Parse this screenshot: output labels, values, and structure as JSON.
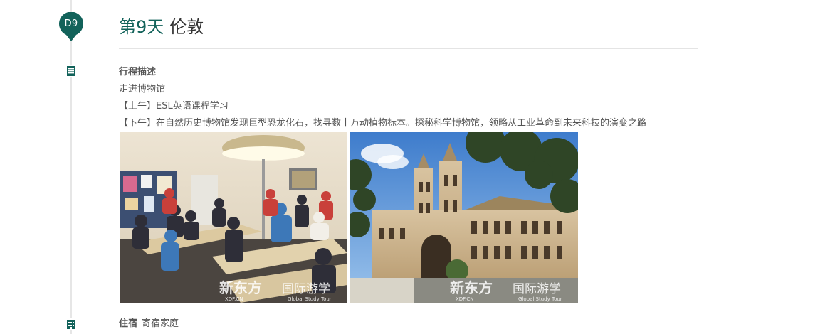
{
  "day": {
    "badge": "D9",
    "title_day": "第9天",
    "title_city": "伦敦"
  },
  "itinerary": {
    "label": "行程描述",
    "lines": [
      "走进博物馆",
      "【上午】ESL英语课程学习",
      "【下午】在自然历史博物馆发现巨型恐龙化石，找寻数十万动植物标本。探秘科学博物馆，领略从工业革命到未来科技的演变之路"
    ]
  },
  "photos": [
    {
      "watermark_brand": "新东方",
      "watermark_sub": "XDF.CN",
      "watermark_tour": "国际游学",
      "watermark_tour_en": "Global Study Tour"
    },
    {
      "watermark_brand": "新东方",
      "watermark_sub": "XDF.CN",
      "watermark_tour": "国际游学",
      "watermark_tour_en": "Global Study Tour"
    }
  ],
  "lodging": {
    "label": "住宿",
    "value": "寄宿家庭"
  },
  "icons": {
    "day_pin": "map-pin-icon",
    "itinerary": "document-icon",
    "lodging": "building-icon"
  },
  "colors": {
    "accent": "#12625a",
    "timeline": "#e6e6e6"
  }
}
